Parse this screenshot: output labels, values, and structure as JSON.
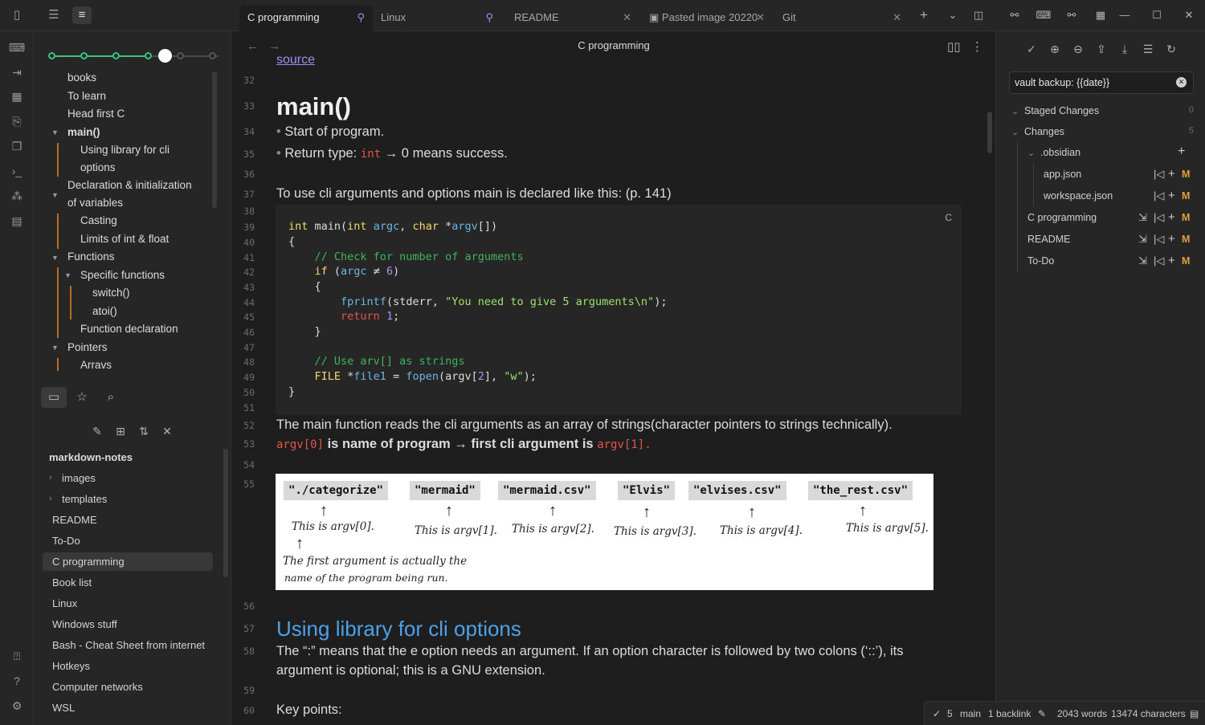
{
  "tabs": [
    {
      "label": "C programming",
      "pinned": true,
      "active": true
    },
    {
      "label": "Linux",
      "pinned": true
    },
    {
      "label": "README",
      "pinned": true
    },
    {
      "label": "Pasted image 20220"
    },
    {
      "label": "Git"
    }
  ],
  "editor": {
    "title": "C programming",
    "source_link": "source",
    "h1": "main()",
    "bullets": [
      "Start of program.",
      "Return type: ",
      " → 0 means success."
    ],
    "bullet_code": "int",
    "p37": "To use cli arguments and options main is declared like this: (p. 141)",
    "code_lang": "C",
    "p52": "The main function reads the cli arguments as an array of strings(character pointers to strings technically).",
    "p53_code1": "argv[0]",
    "p53_mid": " is name of program → first cli argument is ",
    "p53_code2": "argv[1].",
    "h2": "Using library for cli options",
    "p58a": "The “:” means that the e option needs an argument. If an option character is followed by two colons (‘::’), its",
    "p58b": "argument is optional; this is a GNU extension.",
    "p60": "Key points:",
    "line_numbers": [
      "32",
      "33",
      "34",
      "35",
      "36",
      "37",
      "38",
      "39",
      "40",
      "41",
      "42",
      "43",
      "44",
      "45",
      "46",
      "47",
      "48",
      "49",
      "50",
      "51",
      "52",
      "53",
      "54",
      "55",
      "56",
      "57",
      "58",
      "59",
      "60"
    ]
  },
  "figure": {
    "args": [
      "\"./categorize\"",
      "\"mermaid\"",
      "\"mermaid.csv\"",
      "\"Elvis\"",
      "\"elvises.csv\"",
      "\"the_rest.csv\""
    ],
    "captions": [
      "This is argv[0].",
      "This is argv[1].",
      "This is argv[2].",
      "This is argv[3].",
      "This is argv[4].",
      "This is argv[5]."
    ],
    "note1": "The first argument is actually the",
    "note2": "name of the program being run."
  },
  "outline": {
    "items": [
      "books",
      "To learn",
      "Head first C",
      "main()",
      "Using library for cli",
      "options",
      "Declaration & initialization",
      "of variables",
      "Casting",
      "Limits of int & float",
      "Functions",
      "Specific functions",
      "switch()",
      "atoi()",
      "Function declaration",
      "Pointers",
      "Arravs"
    ]
  },
  "files": {
    "vault": "markdown-notes",
    "folders": [
      "images",
      "templates"
    ],
    "items": [
      "README",
      "To-Do",
      "C programming",
      "Book list",
      "Linux",
      "Windows stuff",
      "Bash - Cheat Sheet from internet",
      "Hotkeys",
      "Computer networks",
      "WSL"
    ],
    "active": "C programming"
  },
  "git": {
    "commit_message": "vault backup: {{date}}",
    "staged_label": "Staged Changes",
    "staged_count": "0",
    "changes_label": "Changes",
    "changes_count": "5",
    "folder": ".obsidian",
    "folder_files": [
      "app.json",
      "workspace.json"
    ],
    "files": [
      "C programming",
      "README",
      "To-Do"
    ],
    "status_tag": "M"
  },
  "status": {
    "git_count": "5",
    "branch": "main",
    "backlinks": "1 backlink",
    "words": "2043 words",
    "characters": "13474 characters"
  },
  "colors": {
    "accent": "#a58cf2",
    "heading2": "#4ea1e6",
    "inline_code": "#e0554b",
    "modified": "#e0a13a",
    "slider": "#3ac37e"
  }
}
